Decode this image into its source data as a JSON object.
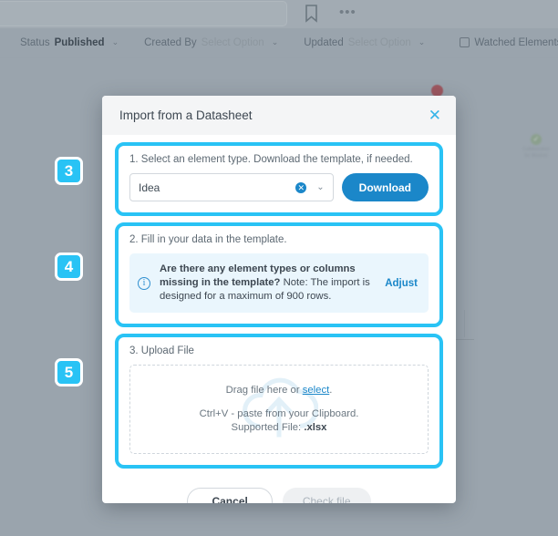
{
  "background": {
    "toolbar": {
      "bookmark_icon": "bookmark-icon",
      "more_icon": "•••"
    },
    "filters": [
      {
        "label": "Status",
        "value": "Published",
        "caret": "⌄",
        "strong": true
      },
      {
        "label": "Created By",
        "value": "Select Option",
        "caret": "⌄",
        "strong": false
      },
      {
        "label": "Updated",
        "value": "Select Option",
        "caret": "⌄",
        "strong": false
      }
    ],
    "watched_checkbox_label": "Watched Elements only",
    "widget": {
      "line1": "Collaboration",
      "line2": "for Wisdom"
    }
  },
  "modal": {
    "title": "Import from a Datasheet",
    "close_icon": "✕",
    "step1": {
      "label": "1. Select an element type. Download the template, if needed.",
      "select_value": "Idea",
      "clear_icon": "✕",
      "chevron_icon": "⌄",
      "download_label": "Download"
    },
    "step2": {
      "label": "2. Fill in your data in the template.",
      "info_icon": "i",
      "question": "Are there any element types or columns missing in the template?",
      "note": "Note: The import is designed for a maximum of 900 rows.",
      "adjust_label": "Adjust"
    },
    "step3": {
      "label": "3. Upload File",
      "drag_prefix": "Drag file here or ",
      "select_link": "select",
      "drag_suffix": ".",
      "clipboard_hint": "Ctrl+V - paste from your Clipboard.",
      "supported_prefix": "Supported File: ",
      "supported_ext": ".xlsx"
    },
    "footer": {
      "cancel_label": "Cancel",
      "check_file_label": "Check file"
    }
  },
  "annotations": {
    "badges": [
      {
        "number": "3"
      },
      {
        "number": "4"
      },
      {
        "number": "5"
      }
    ],
    "highlight_color": "#29c3f5",
    "badge_color": "#29c3f5"
  },
  "colors": {
    "accent_blue": "#1b87c9",
    "highlight_cyan": "#29c3f5",
    "backdrop": "#9aa4ad",
    "info_panel": "#eaf6fd"
  }
}
